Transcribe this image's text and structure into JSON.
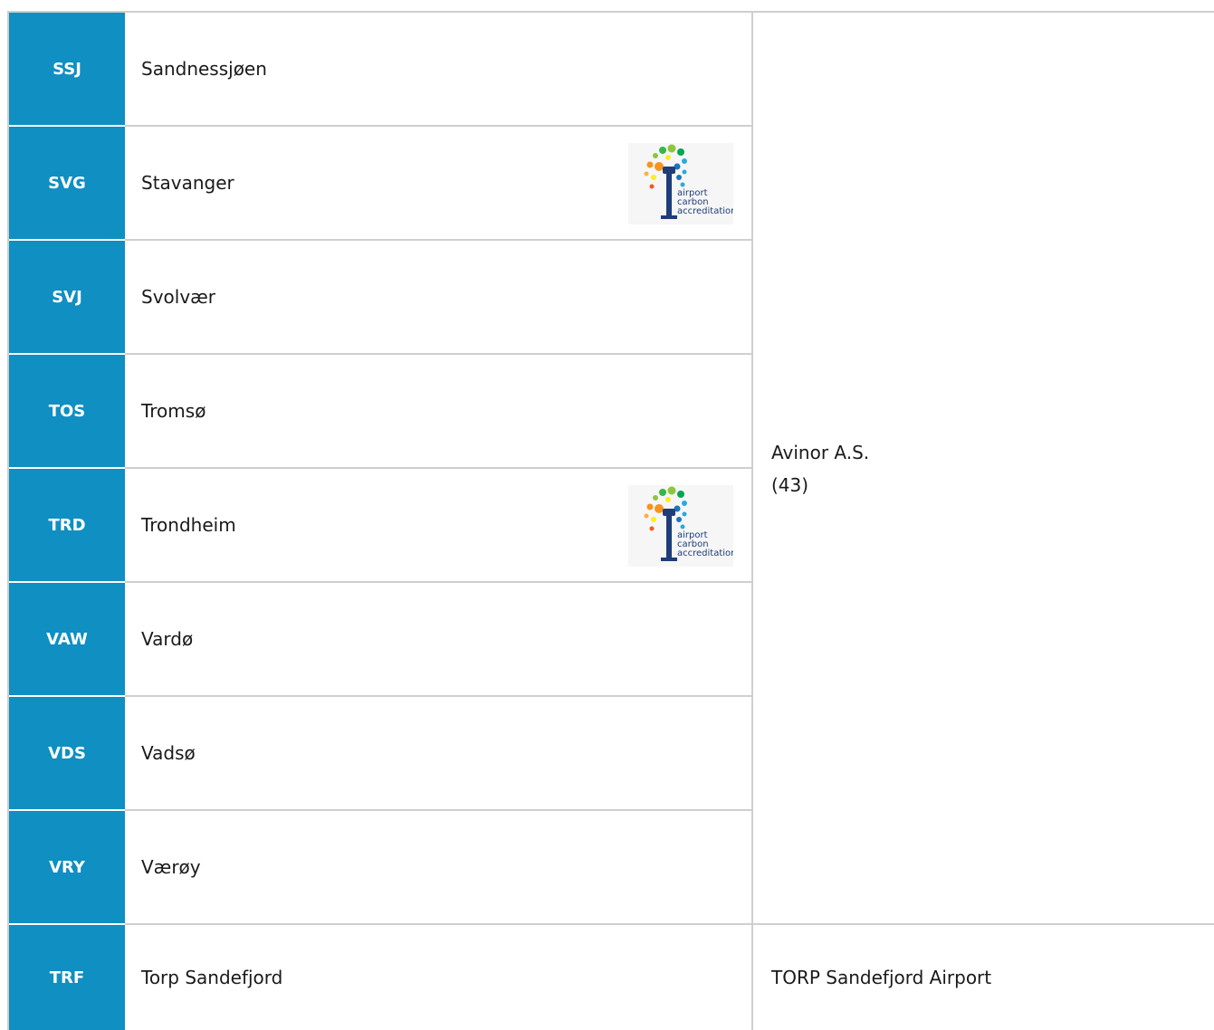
{
  "rows": [
    {
      "code": "SSJ",
      "name": "Sandnessjøen",
      "aca_badge": false
    },
    {
      "code": "SVG",
      "name": "Stavanger",
      "aca_badge": true
    },
    {
      "code": "SVJ",
      "name": "Svolvær",
      "aca_badge": false
    },
    {
      "code": "TOS",
      "name": "Tromsø",
      "aca_badge": false
    },
    {
      "code": "TRD",
      "name": "Trondheim",
      "aca_badge": true
    },
    {
      "code": "VAW",
      "name": "Vardø",
      "aca_badge": false
    },
    {
      "code": "VDS",
      "name": "Vadsø",
      "aca_badge": false
    },
    {
      "code": "VRY",
      "name": "Værøy",
      "aca_badge": false
    },
    {
      "code": "TRF",
      "name": "Torp Sandefjord",
      "aca_badge": false
    }
  ],
  "operators": [
    {
      "name": "Avinor A.S.",
      "count": "(43)"
    },
    {
      "name": "TORP Sandefjord Airport"
    }
  ],
  "aca_logo": {
    "line1": "airport",
    "line2": "carbon",
    "line3": "accreditation"
  },
  "colors": {
    "code_cell_bg": "#0f8fc2",
    "code_text": "#ffffff",
    "divider": "#cfcfcf",
    "logo_tower": "#1f3d7a"
  }
}
